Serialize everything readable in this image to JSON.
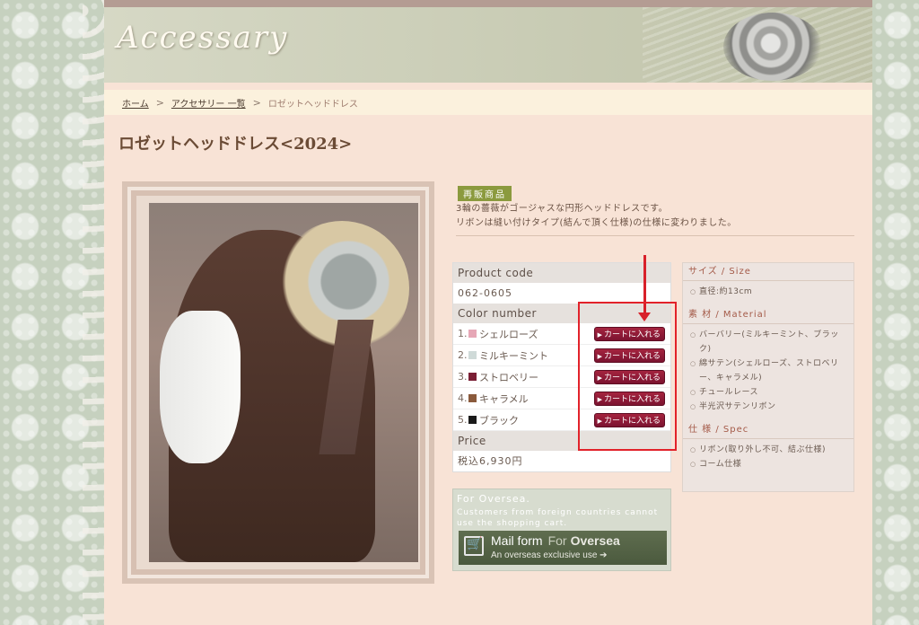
{
  "banner": {
    "title": "Accessary"
  },
  "breadcrumb": {
    "home": "ホーム",
    "list": "アクセサリー 一覧",
    "current": "ロゼットヘッドドレス"
  },
  "page": {
    "title": "ロゼットヘッドドレス<2024>"
  },
  "product": {
    "badge": "再販商品",
    "desc_line1": "3輪の薔薇がゴージャスな円形ヘッドドレスです。",
    "desc_line2": "リボンは縫い付けタイプ(結んで頂く仕様)の仕様に変わりました。",
    "code_label": "Product code",
    "code": "062-0605",
    "color_label": "Color number",
    "colors": [
      {
        "num": "1.",
        "name": "シェルローズ",
        "swatch": "#e6a7b6"
      },
      {
        "num": "2.",
        "name": "ミルキーミント",
        "swatch": "#cfdad8"
      },
      {
        "num": "3.",
        "name": "ストロベリー",
        "swatch": "#7a1e34"
      },
      {
        "num": "4.",
        "name": "キャラメル",
        "swatch": "#8a5a3c"
      },
      {
        "num": "5.",
        "name": "ブラック",
        "swatch": "#1a1a1a"
      }
    ],
    "cart_label": "カートに入れる",
    "price_label": "Price",
    "price": "税込6,930円"
  },
  "oversea": {
    "title": "For Oversea.",
    "text": "Customers from foreign countries cannot use the shopping cart.",
    "btn_main": "Mail form",
    "btn_for": "For",
    "btn_oversea": "Oversea",
    "btn_sub": "An overseas exclusive use ➔"
  },
  "spec": {
    "size_head": "サイズ / Size",
    "size_items": [
      "直径:約13cm"
    ],
    "material_head": "素 材 / Material",
    "material_items": [
      "バーバリー(ミルキーミント、ブラック)",
      "綿サテン(シェルローズ、ストロベリー、キャラメル)",
      "チュールレース",
      "半光沢サテンリボン"
    ],
    "spec_head": "仕 様 / Spec",
    "spec_items": [
      "リボン(取り外し不可、結ぶ仕様)",
      "コーム仕様"
    ]
  }
}
